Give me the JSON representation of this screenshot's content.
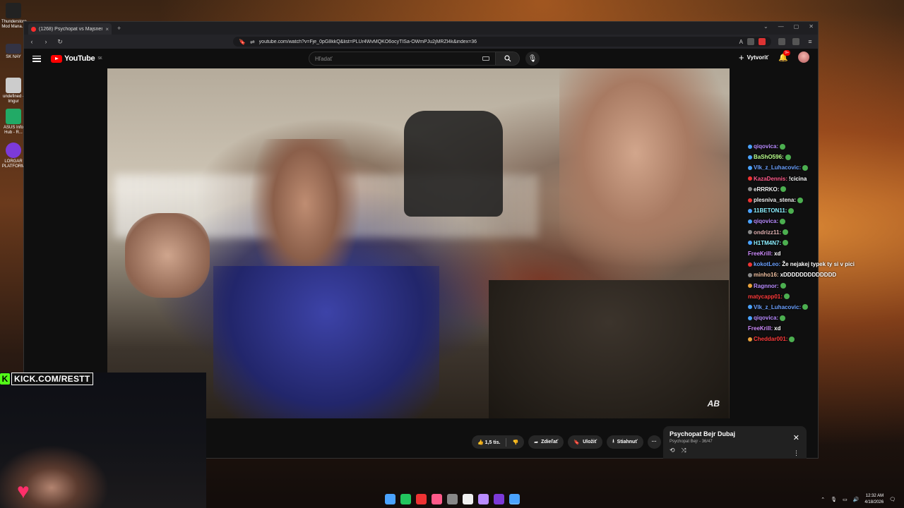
{
  "desktop": {
    "icons": [
      {
        "label": "Thunderstore Mod Mana...",
        "color": "#222"
      },
      {
        "label": "SK NAY",
        "color": "#334"
      },
      {
        "label": "undefined - Imgur",
        "color": "#ccc"
      },
      {
        "label": "ASUS Info Hub - R...",
        "color": "#2a6"
      },
      {
        "label": "LORGAR PLATFORM",
        "color": "#7c3ad8"
      }
    ]
  },
  "browser": {
    "tab_title": "(1268) Psychopat vs Majsner",
    "url": "youtube.com/watch?v=Fje_0pG8kkQ&list=PLUr4WvMQKO6ocyTISa-OWmPJu2jMRZl4k&index=36"
  },
  "youtube": {
    "logo_text": "YouTube",
    "region": "SK",
    "search_placeholder": "Hľadať",
    "create_label": "Vytvoriť",
    "notif_count": "9+",
    "actions": {
      "likes": "1,5 tis.",
      "share": "Zdieľať",
      "save": "Uložiť",
      "download": "Stiahnuť",
      "more": "···"
    },
    "playlist": {
      "title": "Psychopat Bejr  Dubaj",
      "channel": "Psychopat Bejr",
      "position": "36/47"
    },
    "watermark": "AB"
  },
  "chat": [
    {
      "user": "qiqovica:",
      "msg": "",
      "color": "#b98cff",
      "badge": "#4aa3ff"
    },
    {
      "user": "BaShO596:",
      "msg": "",
      "color": "#b9ff8c",
      "badge": "#4aa3ff"
    },
    {
      "user": "Vlk_z_Luhacovic:",
      "msg": "",
      "color": "#6aa0ff",
      "badge": "#4aa3ff"
    },
    {
      "user": "KazaDennis:",
      "msg": "!cicina",
      "color": "#ff5a8a",
      "badge": "#e33"
    },
    {
      "user": "eRRRKO:",
      "msg": "",
      "color": "#f0f0f0",
      "badge": "#888"
    },
    {
      "user": "plesniva_stena:",
      "msg": "",
      "color": "#f0f0f0",
      "badge": "#e33"
    },
    {
      "user": "11BETON11:",
      "msg": "",
      "color": "#8cf0ff",
      "badge": "#4aa3ff"
    },
    {
      "user": "qiqovica:",
      "msg": "",
      "color": "#b98cff",
      "badge": "#4aa3ff"
    },
    {
      "user": "ondrizz11:",
      "msg": "",
      "color": "#e0b0b0",
      "badge": "#888"
    },
    {
      "user": "H1TM4N7:",
      "msg": "",
      "color": "#8cf0ff",
      "badge": "#4aa3ff"
    },
    {
      "user": "FreeKrill:",
      "msg": "xd",
      "color": "#d08cff",
      "badge": ""
    },
    {
      "user": "kokotLeo:",
      "msg": "Že nejakej typek ty si v pici",
      "color": "#6aa0ff",
      "badge": "#e33"
    },
    {
      "user": "minho16:",
      "msg": "xDDDDDDDDDDDDD",
      "color": "#f0c0a0",
      "badge": "#888"
    },
    {
      "user": "Ragnnor:",
      "msg": "",
      "color": "#b98cff",
      "badge": "#e9a23b"
    },
    {
      "user": "matycapp01:",
      "msg": "",
      "color": "#ff3b3b",
      "badge": ""
    },
    {
      "user": "Vlk_z_Luhacovic:",
      "msg": "",
      "color": "#6aa0ff",
      "badge": "#4aa3ff"
    },
    {
      "user": "qiqovica:",
      "msg": "",
      "color": "#b98cff",
      "badge": "#4aa3ff"
    },
    {
      "user": "FreeKrill:",
      "msg": "xd",
      "color": "#d08cff",
      "badge": ""
    },
    {
      "user": "Cheddar001:",
      "msg": "",
      "color": "#ff3b3b",
      "badge": "#e9a23b"
    }
  ],
  "overlay": {
    "kick_url": "KICK.COM/RESTT"
  },
  "taskbar": {
    "time": "12:32 AM",
    "date": "4/18/2026",
    "apps": [
      "#4aa3ff",
      "#22c55e",
      "#e33",
      "#ff5a8a",
      "#888",
      "#f0f0f0",
      "#b98cff",
      "#7c3ad8",
      "#4aa3ff"
    ]
  }
}
